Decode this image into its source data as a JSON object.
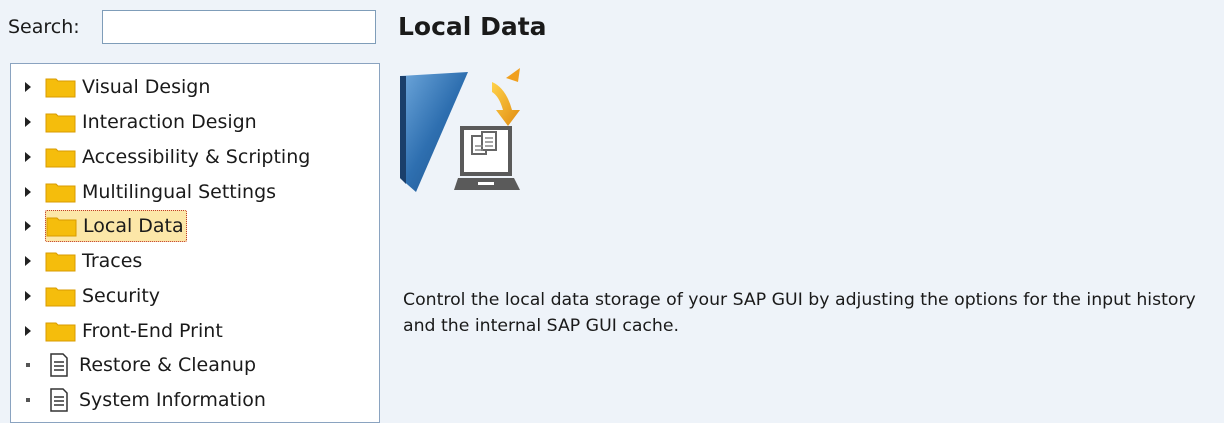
{
  "search": {
    "label": "Search:",
    "value": "",
    "placeholder": ""
  },
  "tree": {
    "items": [
      {
        "label": "Visual Design",
        "type": "folder",
        "expander": "collapsed",
        "selected": false,
        "icon": "folder-icon"
      },
      {
        "label": "Interaction Design",
        "type": "folder",
        "expander": "collapsed",
        "selected": false,
        "icon": "folder-icon"
      },
      {
        "label": "Accessibility & Scripting",
        "type": "folder",
        "expander": "collapsed",
        "selected": false,
        "icon": "folder-icon"
      },
      {
        "label": "Multilingual Settings",
        "type": "folder",
        "expander": "collapsed",
        "selected": false,
        "icon": "folder-icon"
      },
      {
        "label": "Local Data",
        "type": "folder",
        "expander": "collapsed",
        "selected": true,
        "icon": "folder-icon"
      },
      {
        "label": "Traces",
        "type": "folder",
        "expander": "collapsed",
        "selected": false,
        "icon": "folder-icon"
      },
      {
        "label": "Security",
        "type": "folder",
        "expander": "collapsed",
        "selected": false,
        "icon": "folder-icon"
      },
      {
        "label": "Front-End Print",
        "type": "folder",
        "expander": "collapsed",
        "selected": false,
        "icon": "folder-icon"
      },
      {
        "label": "Restore & Cleanup",
        "type": "page",
        "expander": "leaf",
        "selected": false,
        "icon": "document-icon"
      },
      {
        "label": "System Information",
        "type": "page",
        "expander": "leaf",
        "selected": false,
        "icon": "document-icon"
      }
    ]
  },
  "main": {
    "title": "Local Data",
    "icon": "local-data-icon",
    "description": "Control the local data storage of your SAP GUI by adjusting the options for the input history and the internal SAP GUI cache."
  },
  "colors": {
    "background": "#eef3f9",
    "folder": "#f5bd0c",
    "selection": "#fce7a8",
    "selection_border": "#c0392b",
    "hero_blue": "#2e6fb0",
    "hero_orange": "#f0a020"
  }
}
